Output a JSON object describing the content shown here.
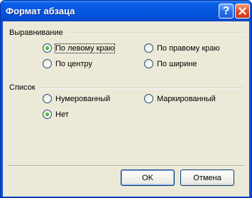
{
  "window": {
    "title": "Формат абзаца"
  },
  "titlebar": {
    "help_label": "?"
  },
  "alignment": {
    "label": "Выравнивание",
    "options": [
      {
        "label": "По левому краю",
        "checked": true
      },
      {
        "label": "По правому краю",
        "checked": false
      },
      {
        "label": "По центру",
        "checked": false
      },
      {
        "label": "По ширине",
        "checked": false
      }
    ]
  },
  "list": {
    "label": "Список",
    "options": [
      {
        "label": "Нумерованный",
        "checked": false
      },
      {
        "label": "Маркированный",
        "checked": false
      },
      {
        "label": "Нет",
        "checked": true
      }
    ]
  },
  "buttons": {
    "ok": "OK",
    "cancel": "Отмена"
  },
  "colors": {
    "titlebar": "#0550d8",
    "client": "#ece9d8",
    "radio_dot": "#21a121"
  }
}
